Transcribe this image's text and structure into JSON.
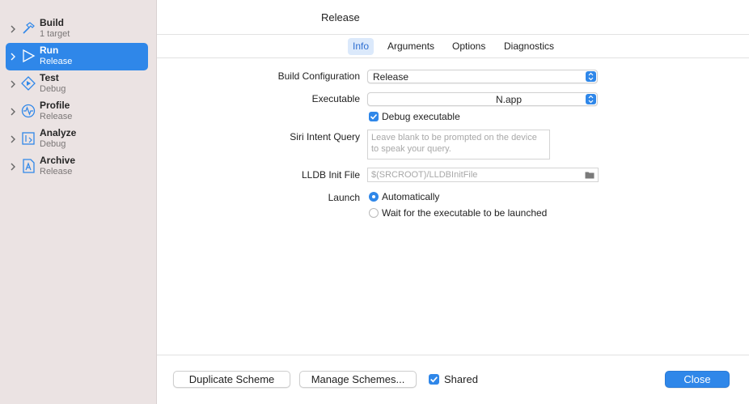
{
  "sidebar": {
    "items": [
      {
        "name": "Build",
        "sub": "1 target",
        "icon": "hammer-icon"
      },
      {
        "name": "Run",
        "sub": "Release",
        "icon": "play-icon"
      },
      {
        "name": "Test",
        "sub": "Debug",
        "icon": "test-diamond-icon"
      },
      {
        "name": "Profile",
        "sub": "Release",
        "icon": "waveform-icon"
      },
      {
        "name": "Analyze",
        "sub": "Debug",
        "icon": "analyze-icon"
      },
      {
        "name": "Archive",
        "sub": "Release",
        "icon": "archive-icon"
      }
    ],
    "selected_index": 1
  },
  "header": {
    "title": "Release",
    "tabs": [
      "Info",
      "Arguments",
      "Options",
      "Diagnostics"
    ],
    "active_tab": "Info"
  },
  "form": {
    "build_config_label": "Build Configuration",
    "build_config_value": "Release",
    "executable_label": "Executable",
    "executable_value": "N.app",
    "debug_executable_label": "Debug executable",
    "debug_executable_checked": true,
    "siri_label": "Siri Intent Query",
    "siri_placeholder": "Leave blank to be prompted on the device to speak your query.",
    "lldb_label": "LLDB Init File",
    "lldb_placeholder": "$(SRCROOT)/LLDBInitFile",
    "launch_label": "Launch",
    "launch_options": [
      "Automatically",
      "Wait for the executable to be launched"
    ],
    "launch_selected": "Automatically"
  },
  "footer": {
    "duplicate_label": "Duplicate Scheme",
    "manage_label": "Manage Schemes...",
    "shared_label": "Shared",
    "shared_checked": true,
    "close_label": "Close"
  },
  "colors": {
    "accent": "#2f87e9",
    "sidebar_bg": "#ebe3e3"
  }
}
